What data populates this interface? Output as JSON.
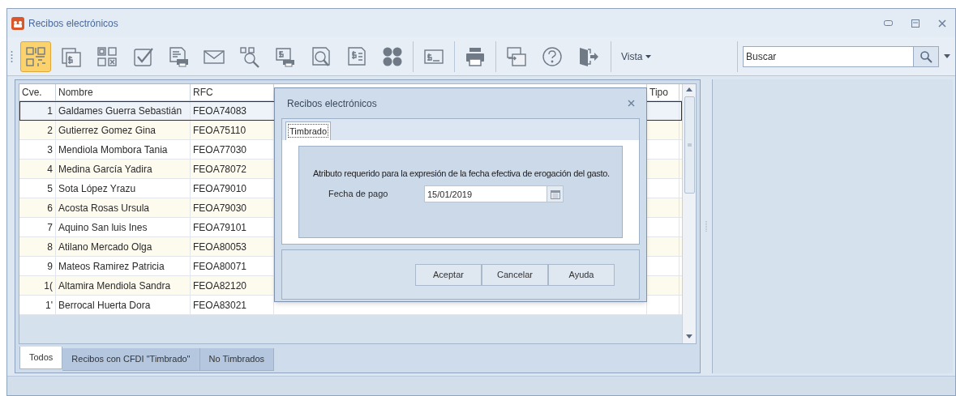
{
  "window": {
    "title": "Recibos electrónicos"
  },
  "toolbar": {
    "buttons": [
      {
        "selected": true
      },
      {
        "selected": false
      },
      {
        "selected": false
      },
      {
        "selected": false
      },
      {
        "selected": false
      },
      {
        "selected": false
      },
      {
        "selected": false
      },
      {
        "selected": false
      },
      {
        "selected": false
      },
      {
        "selected": false
      },
      {
        "selected": false
      },
      {
        "selected": false
      },
      {
        "selected": false
      },
      {
        "selected": false
      },
      {
        "selected": false
      },
      {
        "selected": false
      }
    ],
    "view_menu": "Vista",
    "search": {
      "placeholder": "Buscar"
    }
  },
  "table": {
    "columns": [
      "Cve.",
      "Nombre",
      "RFC",
      "Tipo"
    ],
    "rows": [
      {
        "cve": "1",
        "nombre": "Galdames Guerra Sebastián",
        "rfc": "FEOA74083",
        "selected": true
      },
      {
        "cve": "2",
        "nombre": "Gutierrez Gomez Gina",
        "rfc": "FEOA75110",
        "selected": false
      },
      {
        "cve": "3",
        "nombre": "Mendiola Mombora Tania",
        "rfc": "FEOA77030",
        "selected": false
      },
      {
        "cve": "4",
        "nombre": "Medina García Yadira",
        "rfc": "FEOA78072",
        "selected": false
      },
      {
        "cve": "5",
        "nombre": "Sota López Yrazu",
        "rfc": "FEOA79010",
        "selected": false
      },
      {
        "cve": "6",
        "nombre": "Acosta Rosas Ursula",
        "rfc": "FEOA79030",
        "selected": false
      },
      {
        "cve": "7",
        "nombre": "Aquino San luis Ines",
        "rfc": "FEOA79101",
        "selected": false
      },
      {
        "cve": "8",
        "nombre": "Atilano Mercado Olga",
        "rfc": "FEOA80053",
        "selected": false
      },
      {
        "cve": "9",
        "nombre": "Mateos Ramirez Patricia",
        "rfc": "FEOA80071",
        "selected": false
      },
      {
        "cve": "1(",
        "nombre": "Altamira Mendiola Sandra",
        "rfc": "FEOA82120",
        "selected": false
      },
      {
        "cve": "1'",
        "nombre": "Berrocal Huerta Dora",
        "rfc": "FEOA83021",
        "selected": false
      }
    ]
  },
  "filter_tabs": [
    {
      "label": "Todos",
      "selected": true
    },
    {
      "label": "Recibos con CFDI \"Timbrado\"",
      "selected": false
    },
    {
      "label": "No Timbrados",
      "selected": false
    }
  ],
  "dialog": {
    "title": "Recibos electrónicos",
    "tabs": [
      {
        "label": "Timbrado",
        "selected": true
      }
    ],
    "description": "Atributo requerido para la expresión de la fecha efectiva de erogación del gasto.",
    "field": {
      "label": "Fecha de pago",
      "value": "15/01/2019"
    },
    "buttons": [
      "Aceptar",
      "Cancelar",
      "Ayuda"
    ]
  }
}
